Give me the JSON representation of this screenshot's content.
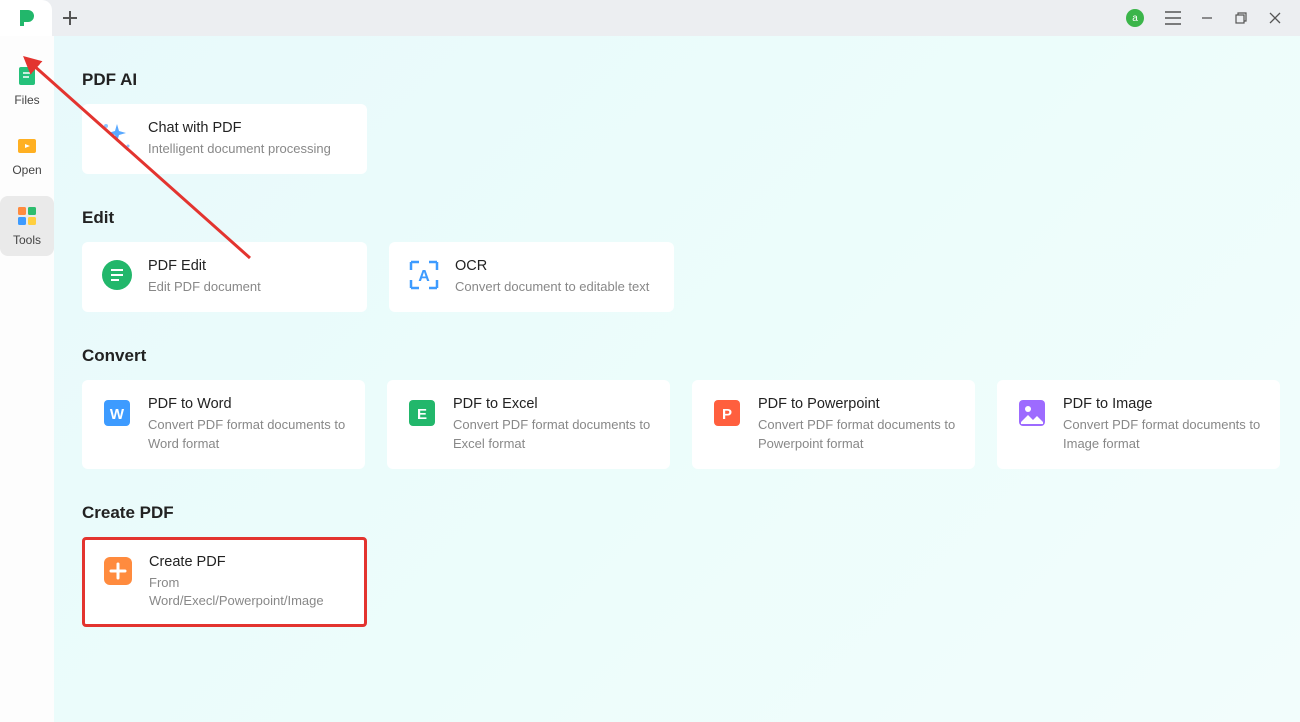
{
  "titlebar": {
    "avatar_letter": "a"
  },
  "sidebar": {
    "files": "Files",
    "open": "Open",
    "tools": "Tools"
  },
  "sections": {
    "pdf_ai": {
      "title": "PDF AI",
      "chat": {
        "title": "Chat with PDF",
        "desc": "Intelligent document processing"
      }
    },
    "edit": {
      "title": "Edit",
      "pdf_edit": {
        "title": "PDF Edit",
        "desc": "Edit PDF document"
      },
      "ocr": {
        "title": "OCR",
        "desc": "Convert document to editable text"
      }
    },
    "convert": {
      "title": "Convert",
      "to_word": {
        "title": "PDF to Word",
        "desc": "Convert PDF format documents to Word format"
      },
      "to_excel": {
        "title": "PDF to Excel",
        "desc": "Convert PDF format documents to Excel format"
      },
      "to_ppt": {
        "title": "PDF to Powerpoint",
        "desc": "Convert PDF format documents to Powerpoint format"
      },
      "to_image": {
        "title": "PDF to Image",
        "desc": "Convert PDF format documents to Image format"
      }
    },
    "create": {
      "title": "Create PDF",
      "create_pdf": {
        "title": "Create PDF",
        "desc": "From Word/Execl/Powerpoint/Image"
      }
    }
  }
}
